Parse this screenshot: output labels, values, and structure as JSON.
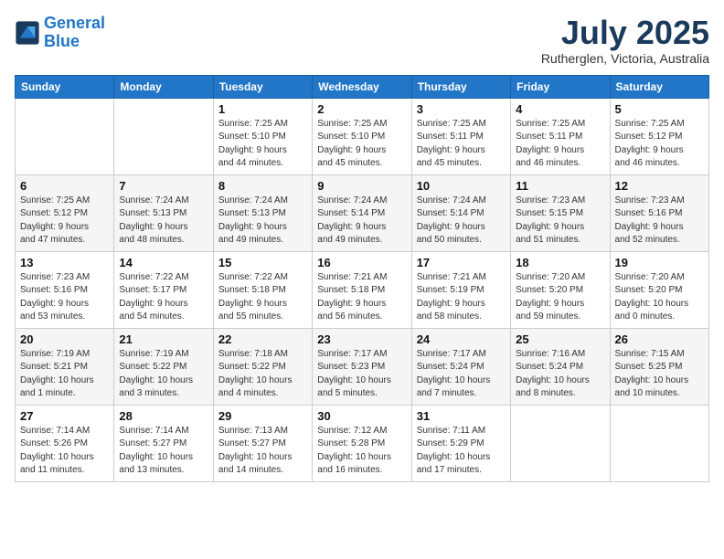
{
  "header": {
    "logo_line1": "General",
    "logo_line2": "Blue",
    "month": "July 2025",
    "location": "Rutherglen, Victoria, Australia"
  },
  "weekdays": [
    "Sunday",
    "Monday",
    "Tuesday",
    "Wednesday",
    "Thursday",
    "Friday",
    "Saturday"
  ],
  "weeks": [
    [
      {
        "day": "",
        "info": ""
      },
      {
        "day": "",
        "info": ""
      },
      {
        "day": "1",
        "info": "Sunrise: 7:25 AM\nSunset: 5:10 PM\nDaylight: 9 hours\nand 44 minutes."
      },
      {
        "day": "2",
        "info": "Sunrise: 7:25 AM\nSunset: 5:10 PM\nDaylight: 9 hours\nand 45 minutes."
      },
      {
        "day": "3",
        "info": "Sunrise: 7:25 AM\nSunset: 5:11 PM\nDaylight: 9 hours\nand 45 minutes."
      },
      {
        "day": "4",
        "info": "Sunrise: 7:25 AM\nSunset: 5:11 PM\nDaylight: 9 hours\nand 46 minutes."
      },
      {
        "day": "5",
        "info": "Sunrise: 7:25 AM\nSunset: 5:12 PM\nDaylight: 9 hours\nand 46 minutes."
      }
    ],
    [
      {
        "day": "6",
        "info": "Sunrise: 7:25 AM\nSunset: 5:12 PM\nDaylight: 9 hours\nand 47 minutes."
      },
      {
        "day": "7",
        "info": "Sunrise: 7:24 AM\nSunset: 5:13 PM\nDaylight: 9 hours\nand 48 minutes."
      },
      {
        "day": "8",
        "info": "Sunrise: 7:24 AM\nSunset: 5:13 PM\nDaylight: 9 hours\nand 49 minutes."
      },
      {
        "day": "9",
        "info": "Sunrise: 7:24 AM\nSunset: 5:14 PM\nDaylight: 9 hours\nand 49 minutes."
      },
      {
        "day": "10",
        "info": "Sunrise: 7:24 AM\nSunset: 5:14 PM\nDaylight: 9 hours\nand 50 minutes."
      },
      {
        "day": "11",
        "info": "Sunrise: 7:23 AM\nSunset: 5:15 PM\nDaylight: 9 hours\nand 51 minutes."
      },
      {
        "day": "12",
        "info": "Sunrise: 7:23 AM\nSunset: 5:16 PM\nDaylight: 9 hours\nand 52 minutes."
      }
    ],
    [
      {
        "day": "13",
        "info": "Sunrise: 7:23 AM\nSunset: 5:16 PM\nDaylight: 9 hours\nand 53 minutes."
      },
      {
        "day": "14",
        "info": "Sunrise: 7:22 AM\nSunset: 5:17 PM\nDaylight: 9 hours\nand 54 minutes."
      },
      {
        "day": "15",
        "info": "Sunrise: 7:22 AM\nSunset: 5:18 PM\nDaylight: 9 hours\nand 55 minutes."
      },
      {
        "day": "16",
        "info": "Sunrise: 7:21 AM\nSunset: 5:18 PM\nDaylight: 9 hours\nand 56 minutes."
      },
      {
        "day": "17",
        "info": "Sunrise: 7:21 AM\nSunset: 5:19 PM\nDaylight: 9 hours\nand 58 minutes."
      },
      {
        "day": "18",
        "info": "Sunrise: 7:20 AM\nSunset: 5:20 PM\nDaylight: 9 hours\nand 59 minutes."
      },
      {
        "day": "19",
        "info": "Sunrise: 7:20 AM\nSunset: 5:20 PM\nDaylight: 10 hours\nand 0 minutes."
      }
    ],
    [
      {
        "day": "20",
        "info": "Sunrise: 7:19 AM\nSunset: 5:21 PM\nDaylight: 10 hours\nand 1 minute."
      },
      {
        "day": "21",
        "info": "Sunrise: 7:19 AM\nSunset: 5:22 PM\nDaylight: 10 hours\nand 3 minutes."
      },
      {
        "day": "22",
        "info": "Sunrise: 7:18 AM\nSunset: 5:22 PM\nDaylight: 10 hours\nand 4 minutes."
      },
      {
        "day": "23",
        "info": "Sunrise: 7:17 AM\nSunset: 5:23 PM\nDaylight: 10 hours\nand 5 minutes."
      },
      {
        "day": "24",
        "info": "Sunrise: 7:17 AM\nSunset: 5:24 PM\nDaylight: 10 hours\nand 7 minutes."
      },
      {
        "day": "25",
        "info": "Sunrise: 7:16 AM\nSunset: 5:24 PM\nDaylight: 10 hours\nand 8 minutes."
      },
      {
        "day": "26",
        "info": "Sunrise: 7:15 AM\nSunset: 5:25 PM\nDaylight: 10 hours\nand 10 minutes."
      }
    ],
    [
      {
        "day": "27",
        "info": "Sunrise: 7:14 AM\nSunset: 5:26 PM\nDaylight: 10 hours\nand 11 minutes."
      },
      {
        "day": "28",
        "info": "Sunrise: 7:14 AM\nSunset: 5:27 PM\nDaylight: 10 hours\nand 13 minutes."
      },
      {
        "day": "29",
        "info": "Sunrise: 7:13 AM\nSunset: 5:27 PM\nDaylight: 10 hours\nand 14 minutes."
      },
      {
        "day": "30",
        "info": "Sunrise: 7:12 AM\nSunset: 5:28 PM\nDaylight: 10 hours\nand 16 minutes."
      },
      {
        "day": "31",
        "info": "Sunrise: 7:11 AM\nSunset: 5:29 PM\nDaylight: 10 hours\nand 17 minutes."
      },
      {
        "day": "",
        "info": ""
      },
      {
        "day": "",
        "info": ""
      }
    ]
  ]
}
